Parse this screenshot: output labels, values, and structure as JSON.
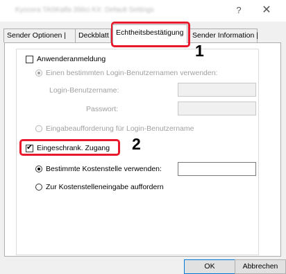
{
  "window": {
    "title": "Kyocera TASKalfa 356ci KX: Default Settings",
    "help": "?",
    "close": "✕"
  },
  "tabs": [
    {
      "label": "Sender Optionen |"
    },
    {
      "label": "Deckblatt"
    },
    {
      "label": "Echtheitsbestätigung"
    },
    {
      "label": "Sender Information |"
    }
  ],
  "user_login": {
    "label": "Anwenderanmeldung",
    "checked": false,
    "use_specific": "Einen bestimmten Login-Benutzernamen verwenden:",
    "login_user_label": "Login-Benutzername:",
    "password_label": "Passwort:",
    "prompt": "Eingabeaufforderung für Login-Benutzername"
  },
  "restricted_access": {
    "label": "Eingeschrank. Zugang",
    "checked": true,
    "use_account": "Bestimmte Kostenstelle verwenden:",
    "account_value": "",
    "prompt_account": "Zur Kostenstelleneingabe auffordern"
  },
  "callouts": [
    "1",
    "2"
  ],
  "buttons": {
    "ok": "OK",
    "cancel": "Abbrechen"
  },
  "colors": {
    "highlight": "#e8192c"
  }
}
